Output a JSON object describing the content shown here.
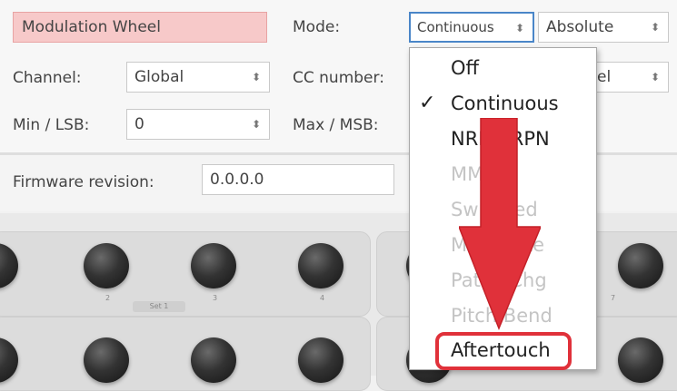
{
  "control": {
    "name": "Modulation Wheel",
    "mode_label": "Mode:",
    "mode_value": "Continuous",
    "abs_value": "Absolute",
    "channel_label": "Channel:",
    "channel_value": "Global",
    "cc_label": "CC number:",
    "cc_value_partial": "el",
    "min_label": "Min / LSB:",
    "min_value": "0",
    "max_label": "Max / MSB:"
  },
  "firmware": {
    "label": "Firmware revision:",
    "value": "0.0.0.0"
  },
  "device": {
    "set_label": "Set 1",
    "knob_numbers": [
      "2",
      "3",
      "4",
      "7"
    ]
  },
  "mode_menu": {
    "items": [
      {
        "label": "Off",
        "enabled": true,
        "checked": false
      },
      {
        "label": "Continuous",
        "enabled": true,
        "checked": true
      },
      {
        "label": "NRPN/RPN",
        "enabled": true,
        "checked": false
      },
      {
        "label": "MMC",
        "enabled": false,
        "checked": false
      },
      {
        "label": "Switched",
        "enabled": false,
        "checked": false
      },
      {
        "label": "MIDI Note",
        "enabled": false,
        "checked": false
      },
      {
        "label": "Patch Chg",
        "enabled": false,
        "checked": false
      },
      {
        "label": "Pitch Bend",
        "enabled": false,
        "checked": false
      },
      {
        "label": "Aftertouch",
        "enabled": true,
        "checked": false
      }
    ],
    "check_mark": "✓"
  },
  "annotation": {
    "arrow_color": "#e0313a",
    "highlight_color": "#e0313a"
  },
  "icons": {
    "updown": "⬍"
  }
}
